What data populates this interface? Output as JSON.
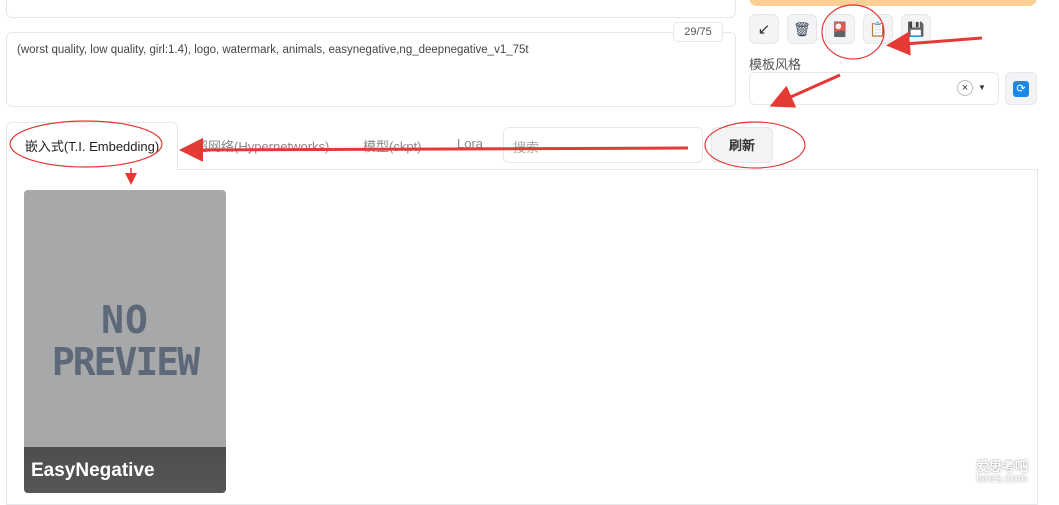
{
  "prompt": {
    "negative_text": "(worst quality, low quality, girl:1.4), logo, watermark, animals, easynegative,ng_deepnegative_v1_75t",
    "token_counter": "29/75"
  },
  "toolbar": {
    "buttons": [
      {
        "name": "arrow-icon",
        "glyph": "↙"
      },
      {
        "name": "trash-icon",
        "glyph": "🗑"
      },
      {
        "name": "card-icon",
        "glyph": "🎴"
      },
      {
        "name": "clipboard-icon",
        "glyph": "📋"
      },
      {
        "name": "save-icon",
        "glyph": "💾"
      }
    ]
  },
  "styles": {
    "label": "模板风格",
    "clear_glyph": "×",
    "caret_glyph": "▼",
    "refresh_glyph": "🔄"
  },
  "tabs": {
    "active": "嵌入式(T.I. Embedding)",
    "items": [
      "超网络(Hypernetworks)",
      "模型(ckpt)",
      "Lora"
    ],
    "search_placeholder": "搜索",
    "refresh_label": "刷新"
  },
  "card": {
    "preview_line1": "NO",
    "preview_line2": "PREVIEW",
    "name": "EasyNegative"
  },
  "watermark": {
    "line1": "爱思考吧",
    "line2": "isres.com"
  },
  "colors": {
    "generate_button": "#fbcf96",
    "annotation_red": "#e53935",
    "card_bg": "#a6a8a9"
  }
}
